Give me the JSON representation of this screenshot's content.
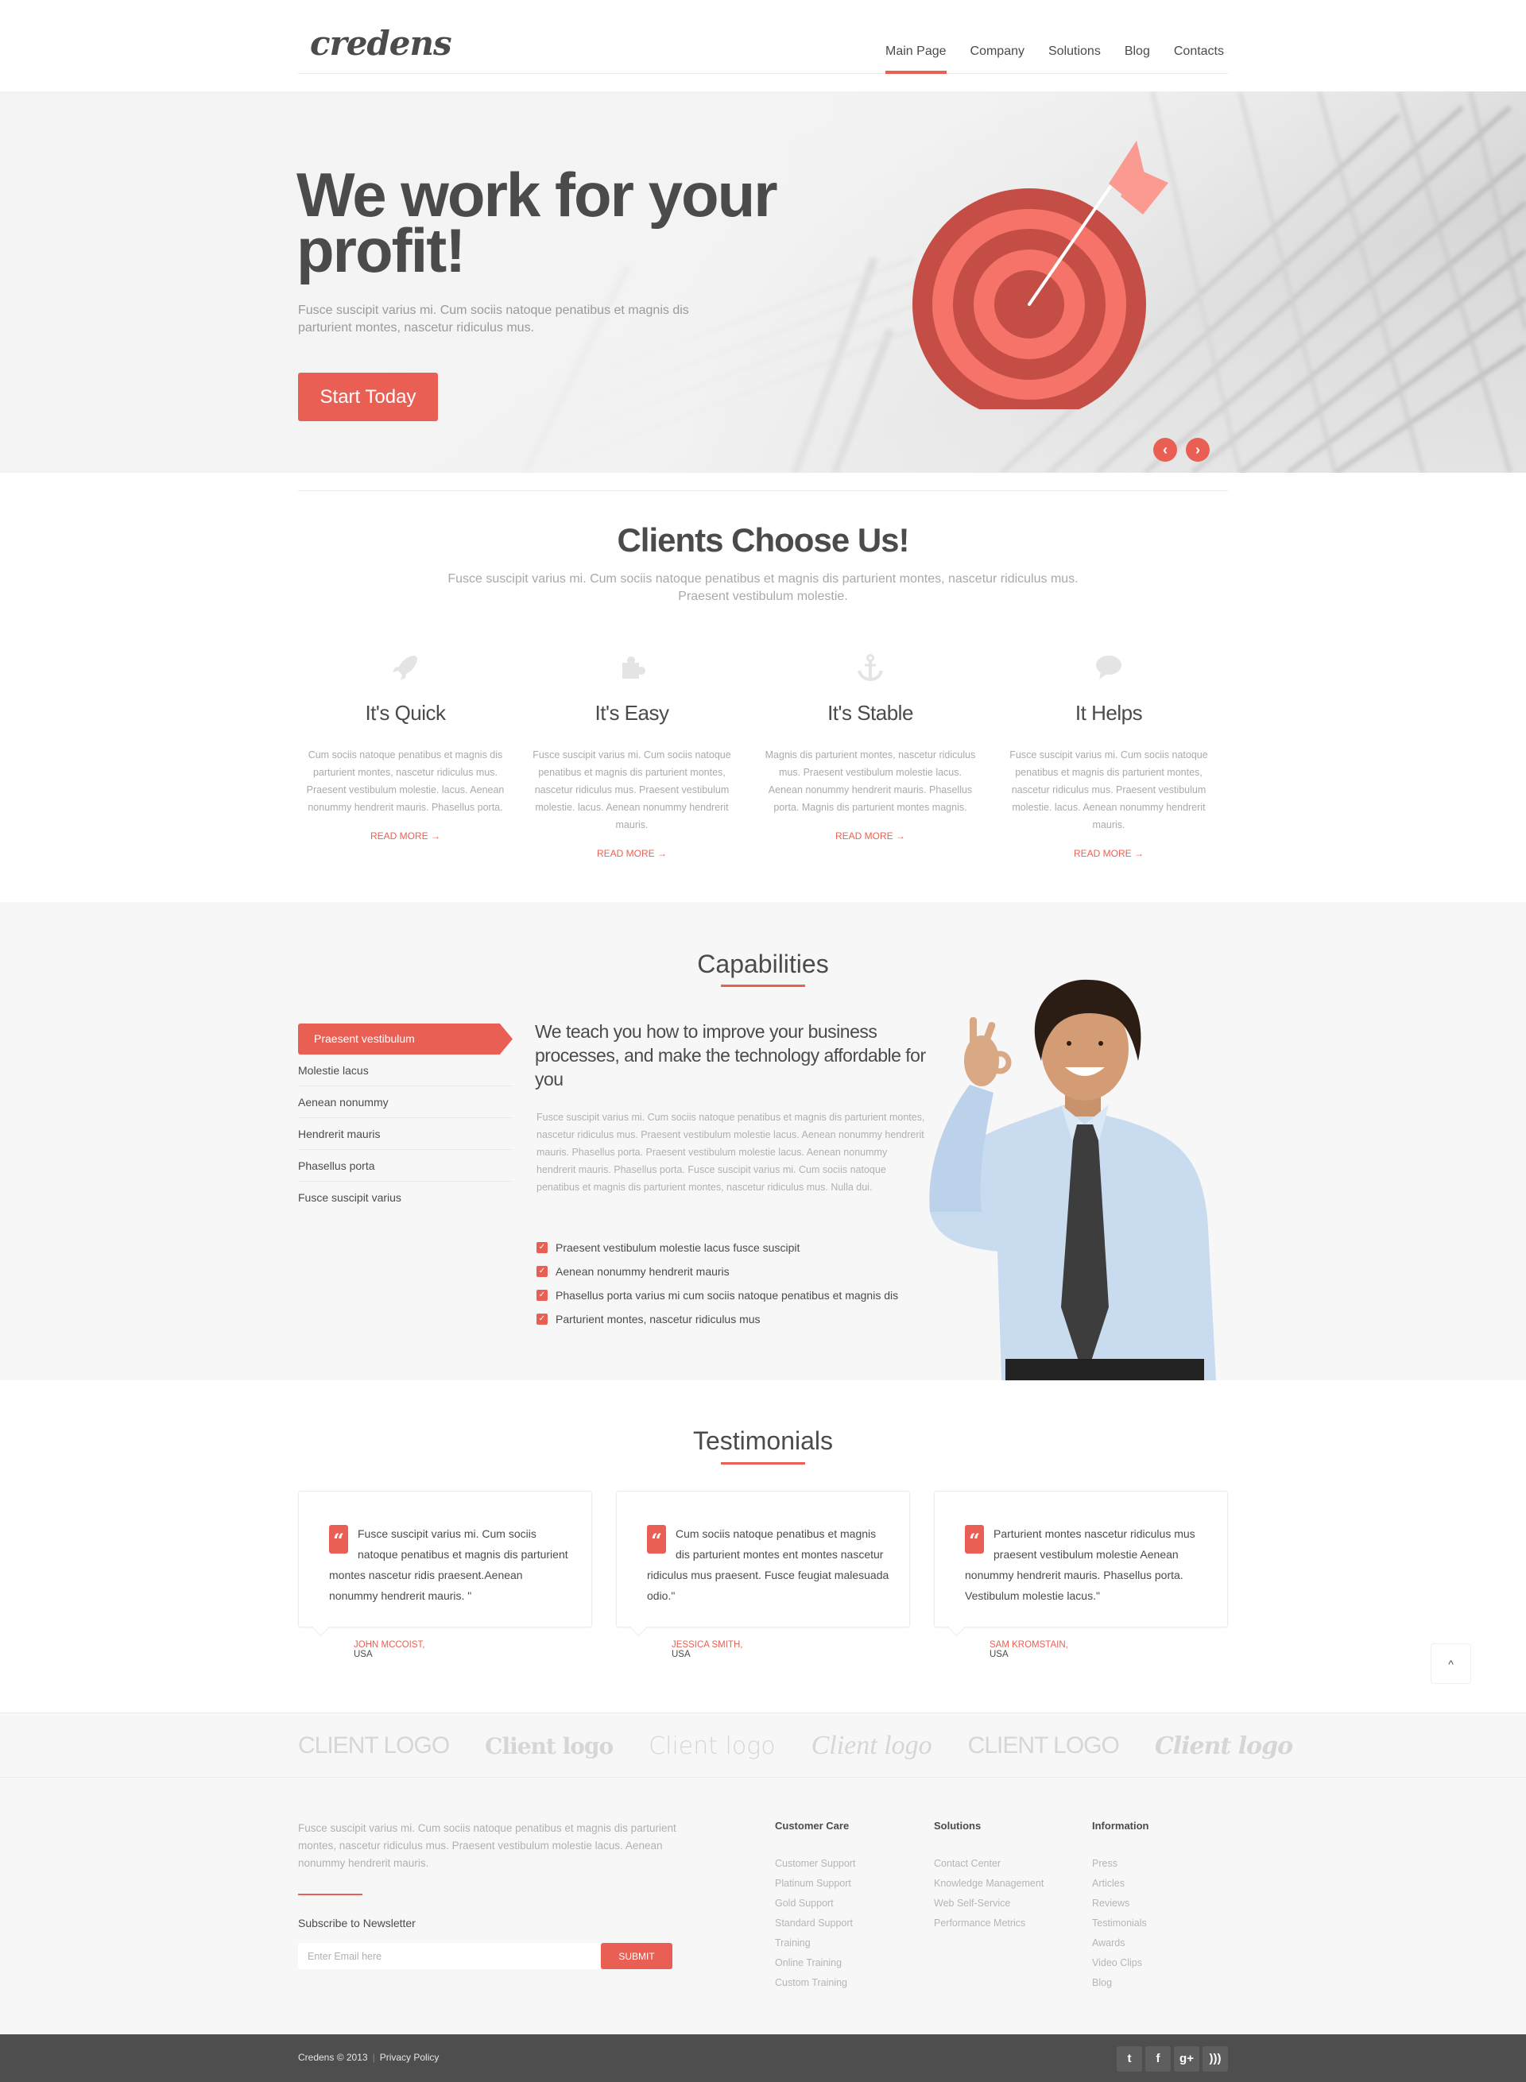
{
  "header": {
    "logo": "credens",
    "nav": [
      {
        "label": "Main Page",
        "active": true
      },
      {
        "label": "Company",
        "active": false
      },
      {
        "label": "Solutions",
        "active": false
      },
      {
        "label": "Blog",
        "active": false
      },
      {
        "label": "Contacts",
        "active": false
      }
    ]
  },
  "hero": {
    "title": "We work for your profit!",
    "subtitle": "Fusce suscipit varius mi. Cum sociis natoque penatibus et magnis dis parturient montes, nascetur ridiculus mus.",
    "cta_label": "Start Today",
    "prev_icon": "chevron-left-icon",
    "next_icon": "chevron-right-icon",
    "prev_glyph": "‹",
    "next_glyph": "›"
  },
  "choose": {
    "title": "Clients Choose Us!",
    "subtitle": "Fusce suscipit varius mi. Cum sociis natoque penatibus et magnis dis parturient montes, nascetur ridiculus mus. Praesent vestibulum molestie.",
    "features": [
      {
        "icon": "rocket-icon",
        "title": "It's Quick",
        "text": "Cum sociis natoque penatibus et magnis dis parturient montes, nascetur ridiculus mus. Praesent vestibulum molestie. lacus. Aenean nonummy hendrerit mauris. Phasellus porta.",
        "link": "READ MORE →"
      },
      {
        "icon": "puzzle-icon",
        "title": "It's Easy",
        "text": "Fusce suscipit varius mi. Cum sociis natoque penatibus et magnis dis parturient montes, nascetur ridiculus mus. Praesent vestibulum molestie. lacus. Aenean nonummy hendrerit mauris.",
        "link": "READ MORE →"
      },
      {
        "icon": "anchor-icon",
        "title": "It's Stable",
        "text": "Magnis dis parturient montes, nascetur ridiculus mus. Praesent vestibulum molestie lacus. Aenean nonummy hendrerit mauris. Phasellus porta. Magnis dis parturient montes magnis.",
        "link": "READ MORE →"
      },
      {
        "icon": "chat-bubble-icon",
        "title": "It Helps",
        "text": "Fusce suscipit varius mi. Cum sociis natoque penatibus et magnis dis parturient montes, nascetur ridiculus mus. Praesent vestibulum molestie. lacus. Aenean nonummy hendrerit mauris.",
        "link": "READ MORE →"
      }
    ]
  },
  "capabilities": {
    "title": "Capabilities",
    "menu": [
      {
        "label": "Praesent vestibulum",
        "active": true
      },
      {
        "label": "Molestie lacus",
        "active": false
      },
      {
        "label": "Aenean nonummy",
        "active": false
      },
      {
        "label": "Hendrerit mauris",
        "active": false
      },
      {
        "label": "Phasellus porta",
        "active": false
      },
      {
        "label": "Fusce suscipit varius",
        "active": false
      }
    ],
    "heading": "We teach you how to improve your business processes, and make the technology affordable for you",
    "text": "Fusce suscipit varius mi. Cum sociis natoque penatibus et magnis dis parturient montes, nascetur ridiculus mus. Praesent vestibulum molestie lacus. Aenean nonummy hendrerit mauris. Phasellus porta. Praesent vestibulum molestie lacus. Aenean nonummy hendrerit mauris. Phasellus porta. Fusce suscipit varius mi. Cum sociis natoque penatibus et magnis dis parturient montes, nascetur ridiculus mus. Nulla dui.",
    "checklist": [
      "Praesent vestibulum molestie lacus fusce suscipit",
      "Aenean nonummy hendrerit mauris",
      "Phasellus porta  varius mi cum sociis natoque penatibus et magnis dis",
      "Parturient montes, nascetur ridiculus mus"
    ],
    "check_glyph": "✓"
  },
  "testimonials": {
    "title": "Testimonials",
    "quote_glyph": "“",
    "items": [
      {
        "text": "Fusce suscipit varius mi. Cum sociis natoque penatibus et magnis dis parturient montes nascetur ridis praesent.Aenean nonummy hendrerit mauris. \"",
        "name": "JOHN MCCOIST,",
        "country": "USA"
      },
      {
        "text": "Cum sociis natoque penatibus et magnis dis parturient montes ent montes nascetur ridiculus mus praesent. Fusce feugiat malesuada odio.\"",
        "name": "JESSICA SMITH,",
        "country": "USA"
      },
      {
        "text": "Parturient montes nascetur ridiculus mus praesent vestibulum molestie Aenean nonummy hendrerit mauris. Phasellus porta. Vestibulum molestie lacus.\"",
        "name": "SAM KROMSTAIN,",
        "country": "USA"
      }
    ],
    "back_to_top_glyph": "^"
  },
  "client_logos": [
    "CLIENT LOGO",
    "Client logo",
    "Client logo",
    "Client logo",
    "CLIENT LOGO",
    "Client logo"
  ],
  "footer": {
    "about": "Fusce suscipit varius mi. Cum sociis natoque penatibus et magnis dis parturient montes, nascetur ridiculus mus. Praesent vestibulum molestie lacus. Aenean nonummy hendrerit mauris.",
    "newsletter_label": "Subscribe to Newsletter",
    "email_placeholder": "Enter Email here",
    "email_value": "",
    "submit_label": "SUBMIT",
    "columns": [
      {
        "title": "Customer Care",
        "links": [
          "Customer Support",
          "Platinum Support",
          "Gold Support",
          "Standard Support",
          "Training",
          "Online Training",
          "Custom Training"
        ]
      },
      {
        "title": "Solutions",
        "links": [
          "Contact Center",
          "Knowledge Management",
          "Web Self-Service",
          "Performance Metrics"
        ]
      },
      {
        "title": "Information",
        "links": [
          "Press",
          "Articles",
          "Reviews",
          "Testimonials",
          "Awards",
          "Video Clips",
          "Blog"
        ]
      }
    ]
  },
  "bottom_bar": {
    "copyright": "Credens © 2013",
    "privacy_label": "Privacy Policy",
    "social": [
      {
        "icon": "twitter-icon",
        "glyph": "t"
      },
      {
        "icon": "facebook-icon",
        "glyph": "f"
      },
      {
        "icon": "google-plus-icon",
        "glyph": "g+"
      },
      {
        "icon": "rss-icon",
        "glyph": ")))"
      }
    ]
  },
  "colors": {
    "accent": "#e95f53",
    "text_dark": "#4b4b4b",
    "text_muted": "#aaaaaa",
    "section_bg": "#f7f7f7",
    "bottom_bar": "#4e4e4e"
  }
}
